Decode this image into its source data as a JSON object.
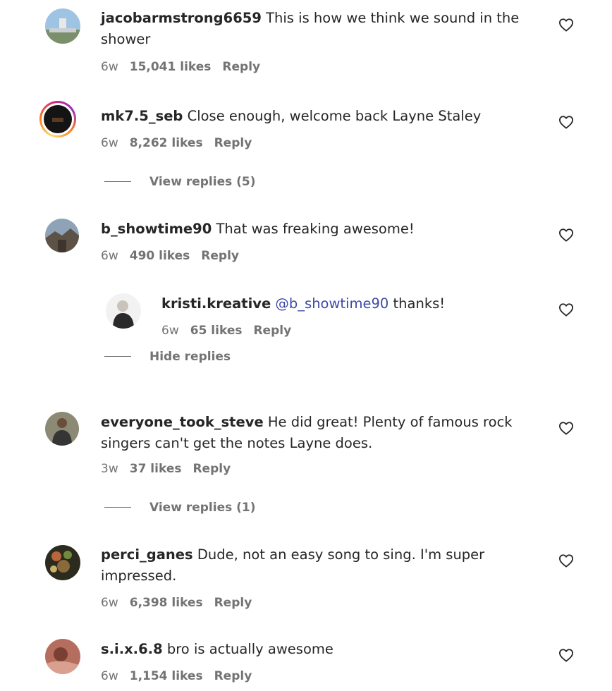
{
  "comments": [
    {
      "username": "jacobarmstrong6659",
      "text": "This is how we think we sound in the shower",
      "age": "6w",
      "likes": "15,041 likes",
      "reply": "Reply"
    },
    {
      "username": "mk7.5_seb",
      "text": "Close enough, welcome back Layne Staley",
      "age": "6w",
      "likes": "8,262 likes",
      "reply": "Reply",
      "thread_toggle": "View replies (5)"
    },
    {
      "username": "b_showtime90",
      "text": "That was freaking awesome!",
      "age": "6w",
      "likes": "490 likes",
      "reply": "Reply",
      "thread_toggle": "Hide replies"
    },
    {
      "username": "everyone_took_steve",
      "text": "He did great! Plenty of famous rock singers can't get the notes Layne does.",
      "age": "3w",
      "likes": "37 likes",
      "reply": "Reply",
      "thread_toggle": "View replies (1)"
    },
    {
      "username": "perci_ganes",
      "text": "Dude, not an easy song to sing. I'm super impressed.",
      "age": "6w",
      "likes": "6,398 likes",
      "reply": "Reply"
    },
    {
      "username": "s.i.x.6.8",
      "text": "bro is actually awesome",
      "age": "6w",
      "likes": "1,154 likes",
      "reply": "Reply"
    }
  ],
  "nested_reply": {
    "username": "kristi.kreative",
    "mention": "@b_showtime90",
    "text": "thanks!",
    "age": "6w",
    "likes": "65 likes",
    "reply": "Reply"
  },
  "icons": {
    "like": "heart-outline-icon"
  },
  "colors": {
    "text": "#262626",
    "secondary": "#737373",
    "mention": "#3d4aa8"
  }
}
